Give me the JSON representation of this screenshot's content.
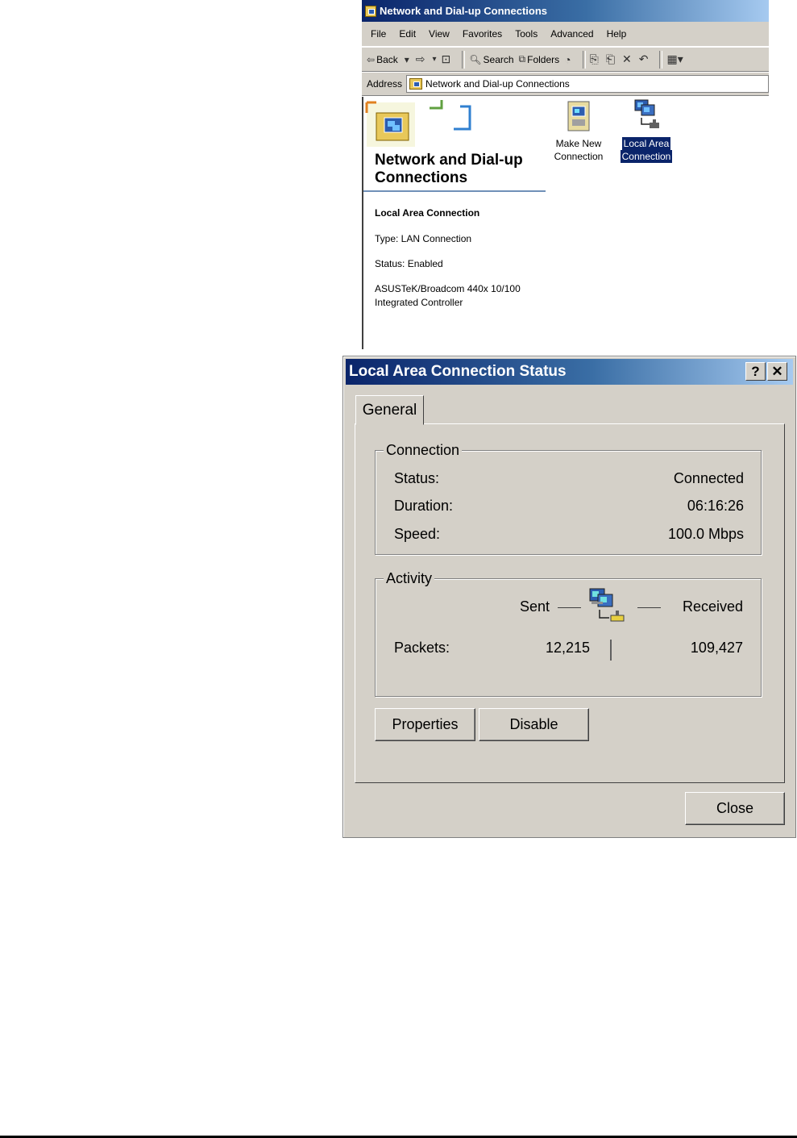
{
  "explorer": {
    "title": "Network and Dial-up Connections",
    "menu": [
      "File",
      "Edit",
      "View",
      "Favorites",
      "Tools",
      "Advanced",
      "Help"
    ],
    "toolbar": {
      "back": "Back",
      "search": "Search",
      "folders": "Folders"
    },
    "address": {
      "label": "Address",
      "value": "Network and Dial-up Connections"
    },
    "banner_title": "Network and Dial-up Connections",
    "details": {
      "name": "Local Area Connection",
      "type": "Type: LAN Connection",
      "status": "Status: Enabled",
      "device_line1": "ASUSTeK/Broadcom 440x 10/100",
      "device_line2": "Integrated Controller"
    },
    "items": [
      {
        "line1": "Make New",
        "line2": "Connection",
        "selected": false
      },
      {
        "line1": "Local Area",
        "line2": "Connection",
        "selected": true
      }
    ]
  },
  "dialog": {
    "title": "Local Area Connection Status",
    "help_button": "?",
    "close_glyph": "✕",
    "tab": "General",
    "connection": {
      "label": "Connection",
      "status_label": "Status:",
      "status_value": "Connected",
      "duration_label": "Duration:",
      "duration_value": "06:16:26",
      "speed_label": "Speed:",
      "speed_value": "100.0 Mbps"
    },
    "activity": {
      "label": "Activity",
      "sent": "Sent",
      "received": "Received",
      "packets_label": "Packets:",
      "packets_sent": "12,215",
      "packets_received": "109,427"
    },
    "buttons": {
      "properties": "Properties",
      "disable": "Disable",
      "close": "Close"
    }
  }
}
